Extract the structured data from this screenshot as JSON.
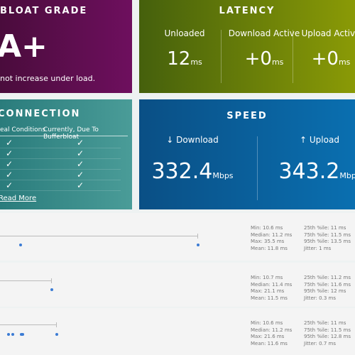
{
  "grade": {
    "title": "BLOAT GRADE",
    "value": "A+",
    "subtitle": "not increase under load."
  },
  "latency": {
    "title": "LATENCY",
    "cols": [
      {
        "label": "Unloaded",
        "value": "12",
        "unit": "ms"
      },
      {
        "label": "Download Active",
        "value": "+0",
        "unit": "ms"
      },
      {
        "label": "Upload Active",
        "value": "+0",
        "unit": "ms"
      }
    ]
  },
  "connection": {
    "title": "CONNECTION",
    "col1": "eal Conditions",
    "col2": "Currently, Due To Bufferbloat",
    "check": "✓",
    "read_more": "Read More"
  },
  "speed": {
    "title": "SPEED",
    "download": {
      "label": "↓ Download",
      "value": "332.4",
      "unit": "Mbps"
    },
    "upload": {
      "label": "↑ Upload",
      "value": "343.2",
      "unit": "Mbps"
    }
  },
  "rows": [
    {
      "left": [
        "Min: 10.6 ms",
        "Median: 11.2 ms",
        "Max: 35.5 ms",
        "Mean: 11.8 ms"
      ],
      "right": [
        "25th %ile: 11 ms",
        "75th %ile: 11.5 ms",
        "95th %ile: 13.5 ms",
        "Jitter: 1 ms"
      ]
    },
    {
      "left": [
        "Min: 10.7 ms",
        "Median: 11.4 ms",
        "Max: 21.1 ms",
        "Mean: 11.5 ms"
      ],
      "right": [
        "25th %ile: 11.2 ms",
        "75th %ile: 11.6 ms",
        "95th %ile: 12 ms",
        "Jitter: 0.3 ms"
      ]
    },
    {
      "left": [
        "Min: 10.6 ms",
        "Median: 11.2 ms",
        "Max: 21.6 ms",
        "Mean: 11.6 ms"
      ],
      "right": [
        "25th %ile: 11 ms",
        "75th %ile: 11.5 ms",
        "95th %ile: 12.8 ms",
        "Jitter: 0.7 ms"
      ]
    }
  ],
  "colors": {
    "grade": "#6e0f5e",
    "latency": "#6a7d0a",
    "connection": "#3a8c8a",
    "speed": "#0a5f9b",
    "dot": "#3b7bd4"
  }
}
